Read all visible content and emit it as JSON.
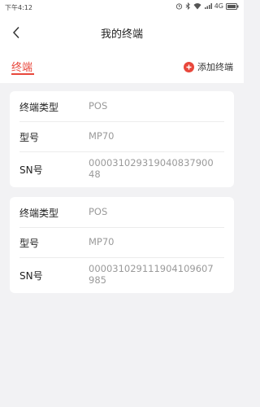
{
  "status_bar": {
    "time": "下午4:12",
    "network": "4G"
  },
  "nav": {
    "title": "我的终端"
  },
  "tabs": {
    "active_label": "终端",
    "add_label": "添加终端"
  },
  "colors": {
    "accent": "#e8473b",
    "label": "#222222",
    "value": "#9a9a9a",
    "background": "#f2f2f4"
  },
  "terminals": [
    {
      "type_label": "终端类型",
      "type_value": "POS",
      "model_label": "型号",
      "model_value": "MP70",
      "sn_label": "SN号",
      "sn_value": "000031029319040837900 48"
    },
    {
      "type_label": "终端类型",
      "type_value": "POS",
      "model_label": "型号",
      "model_value": "MP70",
      "sn_label": "SN号",
      "sn_value": "000031029111904109607985"
    }
  ]
}
